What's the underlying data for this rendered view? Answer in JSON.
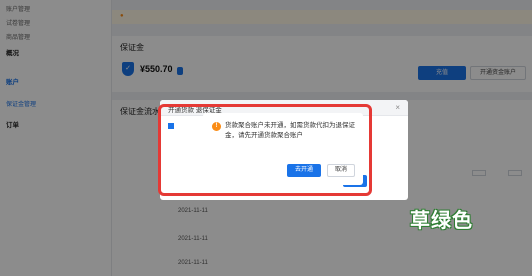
{
  "sidebar": {
    "groups": [
      {
        "title": "",
        "items": [
          "账户管理",
          "",
          "试卷管理",
          "",
          "商品管理",
          "",
          "推广管理",
          ""
        ]
      },
      {
        "title": "概况",
        "items": [
          "",
          "",
          "",
          "",
          "",
          "",
          "",
          ""
        ]
      },
      {
        "title": "账户",
        "items": [
          "",
          "",
          "",
          "",
          "保证金管理",
          "",
          "",
          ""
        ]
      },
      {
        "title": "订单",
        "items": [
          "",
          "",
          "",
          "",
          "",
          "",
          "",
          ""
        ]
      }
    ]
  },
  "notice": {
    "text": ""
  },
  "card": {
    "title": "保证金",
    "subtitle": "",
    "amount_label": "",
    "amount": "¥550.70",
    "amount_tag": "",
    "btn_a": "充值",
    "btn_b": "开通资金账户"
  },
  "list": {
    "title": "保证金流水",
    "filters": [
      "",
      ""
    ],
    "btn_filter": "",
    "btn_export": "",
    "headers": [
      "",
      "",
      "",
      "",
      ""
    ],
    "rows": [
      {
        "c1": "",
        "c2": "2021-11-11",
        "c3": "",
        "c4": "",
        "c5": ""
      },
      {
        "c1": "",
        "c2": "2021-11-11",
        "c3": "",
        "c4": "",
        "c5": ""
      },
      {
        "c1": "",
        "c2": "2021-11-11",
        "c3": "",
        "c4": "",
        "c5": ""
      }
    ]
  },
  "dialog_back": {
    "title": "开通货款 退保证金",
    "body_line1": "",
    "body_line2": "",
    "check_label": ""
  },
  "dialog_front": {
    "message": "货款聚合账户未开通，如需货款代扣为退保证金，请先开通货款聚合账户",
    "open_label": "去开通",
    "cancel_label": "取消"
  },
  "watermark": {
    "text": "草绿色"
  },
  "colors": {
    "primary": "#1a73e8",
    "warning": "#fa8c16",
    "highlight": "#e53935"
  }
}
